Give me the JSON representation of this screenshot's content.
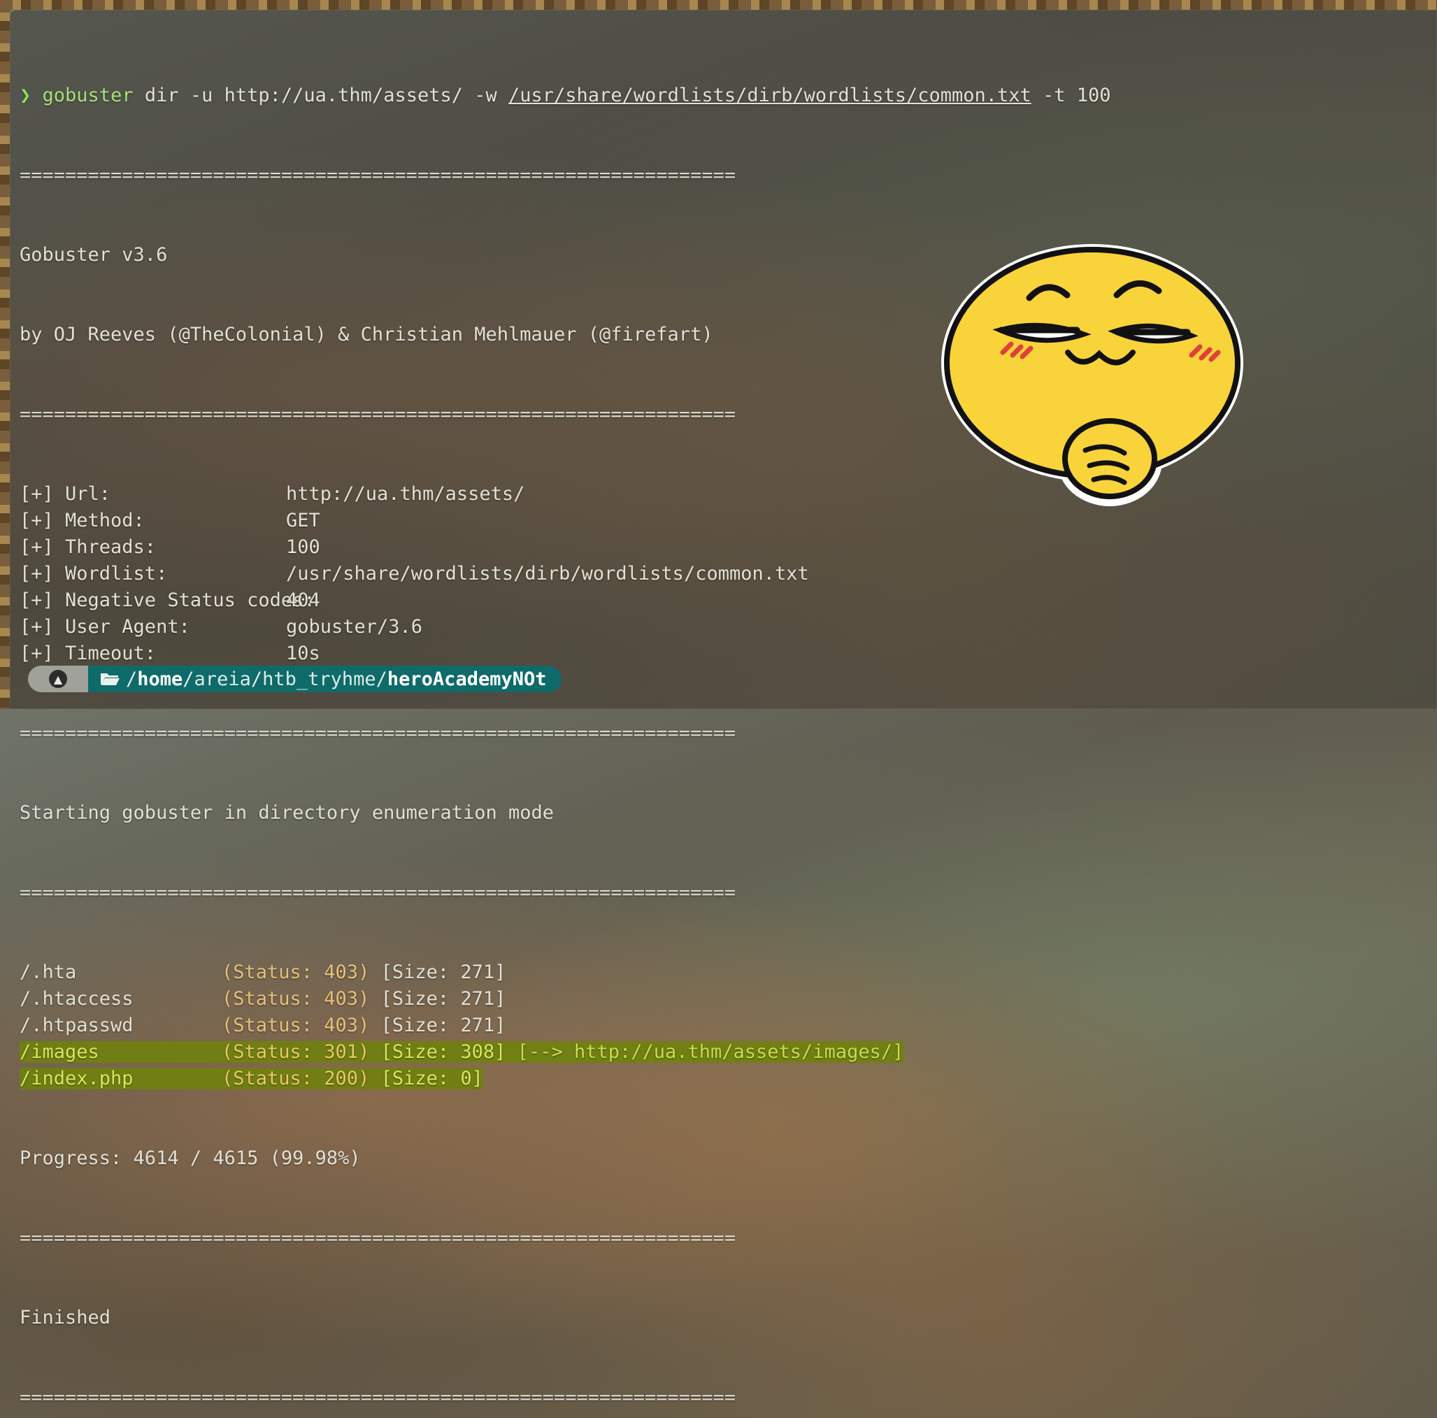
{
  "command": {
    "prompt_symbol": "❯",
    "program": "gobuster",
    "args_before": " dir -u http://ua.thm/assets/ -w ",
    "wordlist_arg": "/usr/share/wordlists/dirb/wordlists/common.txt",
    "args_after": " -t 100"
  },
  "separator": "===============================================================",
  "banner": {
    "version": "Gobuster v3.6",
    "authors": "by OJ Reeves (@TheColonial) & Christian Mehlmauer (@firefart)"
  },
  "config": [
    {
      "key": "[+] Url:",
      "value": "http://ua.thm/assets/"
    },
    {
      "key": "[+] Method:",
      "value": "GET"
    },
    {
      "key": "[+] Threads:",
      "value": "100"
    },
    {
      "key": "[+] Wordlist:",
      "value": "/usr/share/wordlists/dirb/wordlists/common.txt"
    },
    {
      "key": "[+] Negative Status codes:",
      "value": "404"
    },
    {
      "key": "[+] User Agent:",
      "value": "gobuster/3.6"
    },
    {
      "key": "[+] Timeout:",
      "value": "10s"
    }
  ],
  "start_message": "Starting gobuster in directory enumeration mode",
  "results": [
    {
      "path": "/.hta",
      "status": "(Status: 403)",
      "size": "[Size: 271]",
      "redirect": "",
      "highlighted": false
    },
    {
      "path": "/.htaccess",
      "status": "(Status: 403)",
      "size": "[Size: 271]",
      "redirect": "",
      "highlighted": false
    },
    {
      "path": "/.htpasswd",
      "status": "(Status: 403)",
      "size": "[Size: 271]",
      "redirect": "",
      "highlighted": false
    },
    {
      "path": "/images",
      "status": "(Status: 301)",
      "size": "[Size: 308]",
      "redirect": "[--> http://ua.thm/assets/images/]",
      "highlighted": true
    },
    {
      "path": "/index.php",
      "status": "(Status: 200)",
      "size": "[Size: 0]",
      "redirect": "",
      "highlighted": true
    }
  ],
  "progress": "Progress: 4614 / 4615 (99.98%)",
  "finished": "Finished",
  "shell_prompt": {
    "os_icon": "arch-linux-icon",
    "folder_icon": "folder-open-icon",
    "path_parts": [
      {
        "text": "/",
        "bold": false
      },
      {
        "text": "home",
        "bold": true
      },
      {
        "text": "/areia/htb_tryhme/",
        "bold": false
      },
      {
        "text": "heroAcademyNOt",
        "bold": true
      }
    ]
  },
  "colors": {
    "prompt_green": "#8fe05c",
    "highlight_bg": "#6e820a",
    "prompt_teal": "#0f6a6a"
  }
}
